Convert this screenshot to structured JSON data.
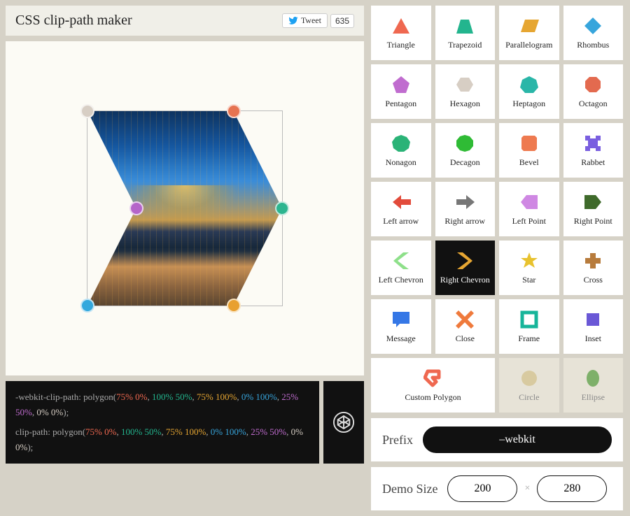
{
  "header": {
    "title": "CSS clip-path maker",
    "tweet_label": "Tweet",
    "tweet_count": "635"
  },
  "code": {
    "line1_prefix": "-webkit-clip-path: ",
    "line2_prefix": "clip-path: ",
    "func": "polygon(",
    "points": [
      "75% 0%",
      "100% 50%",
      "75% 100%",
      "0% 100%",
      "25% 50%",
      "0% 0%"
    ],
    "close": ");"
  },
  "shapes": {
    "items": [
      {
        "label": "Triangle"
      },
      {
        "label": "Trapezoid"
      },
      {
        "label": "Parallelogram"
      },
      {
        "label": "Rhombus"
      },
      {
        "label": "Pentagon"
      },
      {
        "label": "Hexagon"
      },
      {
        "label": "Heptagon"
      },
      {
        "label": "Octagon"
      },
      {
        "label": "Nonagon"
      },
      {
        "label": "Decagon"
      },
      {
        "label": "Bevel"
      },
      {
        "label": "Rabbet"
      },
      {
        "label": "Left arrow"
      },
      {
        "label": "Right arrow"
      },
      {
        "label": "Left Point"
      },
      {
        "label": "Right Point"
      },
      {
        "label": "Left Chevron"
      },
      {
        "label": "Right Chevron"
      },
      {
        "label": "Star"
      },
      {
        "label": "Cross"
      },
      {
        "label": "Message"
      },
      {
        "label": "Close"
      },
      {
        "label": "Frame"
      },
      {
        "label": "Inset"
      },
      {
        "label": "Custom Polygon"
      },
      {
        "label": "Circle"
      },
      {
        "label": "Ellipse"
      }
    ],
    "selected_index": 17
  },
  "prefix": {
    "label": "Prefix",
    "value": "–webkit"
  },
  "size": {
    "label": "Demo Size",
    "width": "200",
    "height": "280",
    "sep": "×"
  },
  "colors": {
    "triangle": "#ef6850",
    "trapezoid": "#23b58e",
    "parallelogram": "#e6a632",
    "rhombus": "#37a5dc",
    "pentagon": "#c06ccf",
    "hexagon": "#d7cec4",
    "heptagon": "#2ab6a8",
    "octagon": "#e36a4f",
    "nonagon": "#2ab377",
    "decagon": "#2fbb35",
    "bevel": "#ee7a50",
    "rabbet": "#7a5fe0",
    "larrow": "#e24b3b",
    "rarrow": "#777",
    "lpoint": "#cf88e3",
    "rpoint": "#3f6a2b",
    "lchev": "#8ee08a",
    "rchev": "#e6a632",
    "star": "#e8c22e",
    "cross": "#b77b3c",
    "message": "#3577e6",
    "close": "#ef7a3c",
    "frame": "#17b59a",
    "inset": "#6a58d6",
    "custom": "#ef6850",
    "circle": "#d8caa0",
    "ellipse": "#7eb06a"
  }
}
